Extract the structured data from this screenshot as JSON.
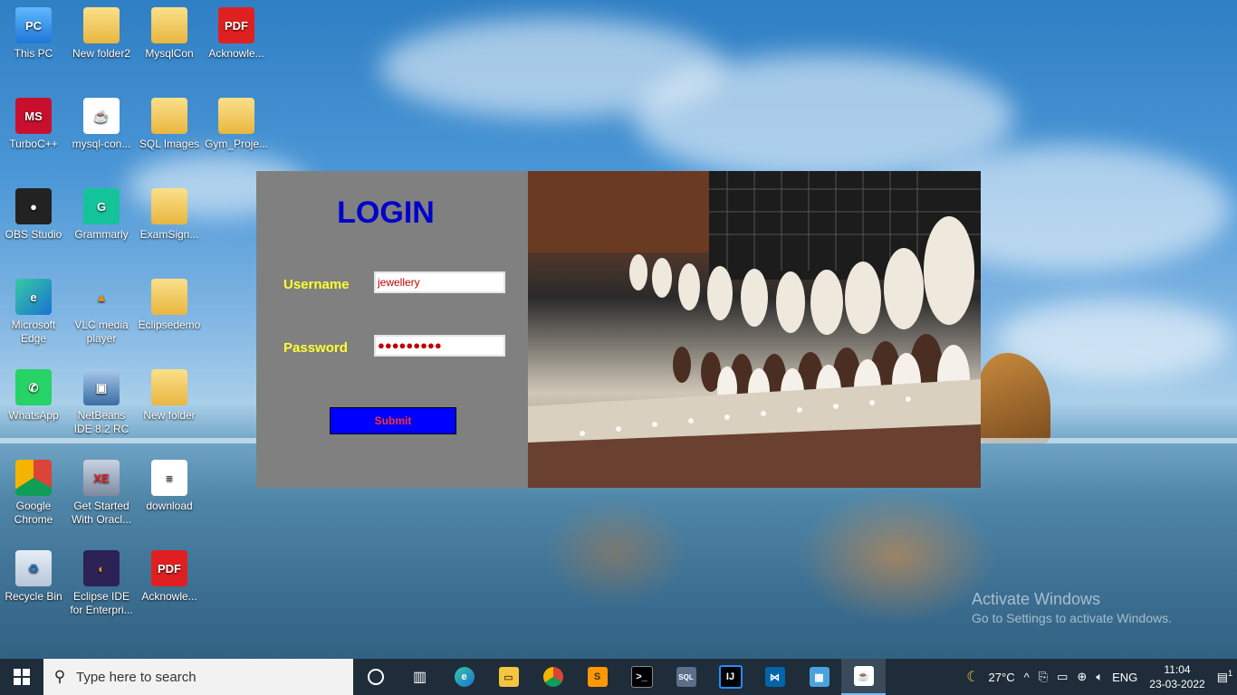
{
  "desktop": {
    "icons": [
      {
        "label": "This PC",
        "glyph": "PC",
        "icon": "computer-icon"
      },
      {
        "label": "New folder2",
        "glyph": "",
        "icon": "folder-icon"
      },
      {
        "label": "MysqlCon",
        "glyph": "",
        "icon": "folder-icon"
      },
      {
        "label": "Acknowle...",
        "glyph": "PDF",
        "icon": "pdf-icon"
      },
      {
        "label": "TurboC++",
        "glyph": "MS",
        "icon": "turboc-icon"
      },
      {
        "label": "mysql-con...",
        "glyph": "☕",
        "icon": "java-jar-icon"
      },
      {
        "label": "SQL Images",
        "glyph": "",
        "icon": "folder-icon"
      },
      {
        "label": "Gym_Proje...",
        "glyph": "",
        "icon": "folder-icon"
      },
      {
        "label": "OBS Studio",
        "glyph": "●",
        "icon": "obs-icon"
      },
      {
        "label": "Grammarly",
        "glyph": "G",
        "icon": "grammarly-icon"
      },
      {
        "label": "ExamSign...",
        "glyph": "",
        "icon": "folder-icon"
      },
      {
        "label": "Microsoft Edge",
        "glyph": "e",
        "icon": "edge-icon"
      },
      {
        "label": "VLC media player",
        "glyph": "▲",
        "icon": "vlc-icon"
      },
      {
        "label": "Eclipsedemo",
        "glyph": "",
        "icon": "folder-icon"
      },
      {
        "label": "WhatsApp",
        "glyph": "✆",
        "icon": "whatsapp-icon"
      },
      {
        "label": "NetBeans IDE 8.2 RC",
        "glyph": "▣",
        "icon": "netbeans-icon"
      },
      {
        "label": "New folder",
        "glyph": "",
        "icon": "folder-icon"
      },
      {
        "label": "Google Chrome",
        "glyph": "●",
        "icon": "chrome-icon"
      },
      {
        "label": "Get Started With Oracl...",
        "glyph": "XE",
        "icon": "oracle-icon"
      },
      {
        "label": "download",
        "glyph": "≡",
        "icon": "document-icon"
      },
      {
        "label": "Recycle Bin",
        "glyph": "♻",
        "icon": "recycle-bin-icon"
      },
      {
        "label": "Eclipse IDE for Enterpri...",
        "glyph": "◐",
        "icon": "eclipse-icon"
      },
      {
        "label": "Acknowle...",
        "glyph": "PDF",
        "icon": "pdf-icon"
      }
    ]
  },
  "login": {
    "title": "LOGIN",
    "username_label": "Username",
    "username_value": "jewellery",
    "password_label": "Password",
    "password_value": "●●●●●●●●●",
    "submit_label": "Submit"
  },
  "watermark": {
    "line1": "Activate Windows",
    "line2": "Go to Settings to activate Windows."
  },
  "taskbar": {
    "search_placeholder": "Type here to search",
    "apps": [
      "cortana-icon",
      "task-view-icon",
      "edge-icon",
      "file-explorer-icon",
      "chrome-icon",
      "sublime-icon",
      "terminal-icon",
      "sql-developer-icon",
      "intellij-icon",
      "vscode-icon",
      "control-panel-icon",
      "java-app-icon"
    ],
    "weather_temp": "27°C",
    "language": "ENG",
    "time": "11:04",
    "date": "23-03-2022",
    "notification_count": "1"
  },
  "colors": {
    "login_panel_bg": "#808080",
    "login_title": "#0000cc",
    "label_color": "#ffff33",
    "submit_bg": "#0000ff",
    "submit_text": "#ff3030",
    "taskbar_bg": "#1f2d3a"
  }
}
